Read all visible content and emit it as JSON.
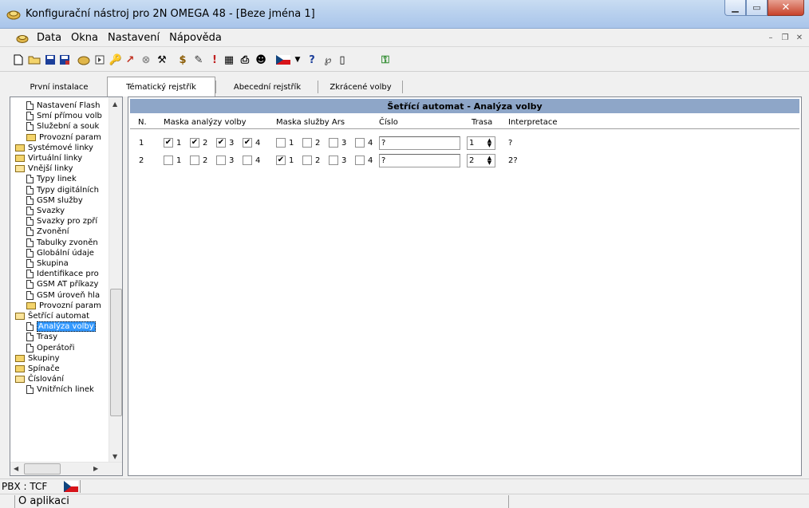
{
  "window": {
    "title": "Konfigurační nástroj pro 2N OMEGA 48 - [Beze jména 1]"
  },
  "menu": [
    {
      "label": "Data"
    },
    {
      "label": "Okna"
    },
    {
      "label": "Nastavení"
    },
    {
      "label": "Nápověda"
    }
  ],
  "tabs": [
    {
      "label": "První instalace"
    },
    {
      "label": "Tématický rejstřík"
    },
    {
      "label": "Abecední rejstřík"
    },
    {
      "label": "Zkrácené volby"
    }
  ],
  "tree": [
    {
      "label": "Nastavení Flash",
      "type": "doc",
      "indent": 1
    },
    {
      "label": "Smí přímou volb",
      "type": "doc",
      "indent": 1
    },
    {
      "label": "Služební a souk",
      "type": "doc",
      "indent": 1
    },
    {
      "label": "Provozní param",
      "type": "folder",
      "indent": 1
    },
    {
      "label": "Systémové linky",
      "type": "folder",
      "indent": 0
    },
    {
      "label": "Virtuální linky",
      "type": "folder",
      "indent": 0
    },
    {
      "label": "Vnější linky",
      "type": "folder-open",
      "indent": 0
    },
    {
      "label": "Typy linek",
      "type": "doc",
      "indent": 1
    },
    {
      "label": "Typy digitálních",
      "type": "doc",
      "indent": 1
    },
    {
      "label": "GSM služby",
      "type": "doc",
      "indent": 1
    },
    {
      "label": "Svazky",
      "type": "doc",
      "indent": 1
    },
    {
      "label": "Svazky pro zpří",
      "type": "doc",
      "indent": 1
    },
    {
      "label": "Zvonění",
      "type": "doc",
      "indent": 1
    },
    {
      "label": "Tabulky zvoněn",
      "type": "doc",
      "indent": 1
    },
    {
      "label": "Globální údaje",
      "type": "doc",
      "indent": 1
    },
    {
      "label": "Skupina",
      "type": "doc",
      "indent": 1
    },
    {
      "label": "Identifikace pro",
      "type": "doc",
      "indent": 1
    },
    {
      "label": "GSM AT příkazy",
      "type": "doc",
      "indent": 1
    },
    {
      "label": "GSM úroveň hla",
      "type": "doc",
      "indent": 1
    },
    {
      "label": "Provozní param",
      "type": "folder",
      "indent": 1
    },
    {
      "label": "Šetřící automat",
      "type": "folder-open",
      "indent": 0
    },
    {
      "label": "Analýza volby",
      "type": "doc",
      "indent": 1,
      "selected": true
    },
    {
      "label": "Trasy",
      "type": "doc",
      "indent": 1
    },
    {
      "label": "Operátoři",
      "type": "doc",
      "indent": 1
    },
    {
      "label": "Skupiny",
      "type": "folder",
      "indent": 0
    },
    {
      "label": "Spínače",
      "type": "folder",
      "indent": 0
    },
    {
      "label": "Číslování",
      "type": "folder-open",
      "indent": 0
    },
    {
      "label": "Vnitřních linek",
      "type": "doc",
      "indent": 1
    }
  ],
  "panel": {
    "title": "Šetřící automat - Analýza volby",
    "columns": {
      "n": "N.",
      "mask": "Maska analýzy volby",
      "ars": "Maska služby Ars",
      "number": "Číslo",
      "route": "Trasa",
      "interp": "Interpretace"
    },
    "rows": [
      {
        "n": "1",
        "mask": [
          true,
          true,
          true,
          true
        ],
        "ars": [
          false,
          false,
          false,
          false
        ],
        "number": "?",
        "route": "1",
        "interp": "?"
      },
      {
        "n": "2",
        "mask": [
          false,
          false,
          false,
          false
        ],
        "ars": [
          true,
          false,
          false,
          false
        ],
        "number": "?",
        "route": "2",
        "interp": "2?"
      }
    ],
    "checkbox_labels": [
      "1",
      "2",
      "3",
      "4"
    ]
  },
  "status": {
    "pbx": "PBX : TCF",
    "about": "O aplikaci"
  }
}
